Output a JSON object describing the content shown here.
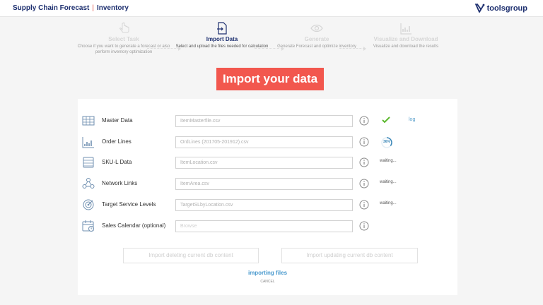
{
  "header": {
    "app_name": "Supply Chain Forecast",
    "separator": "|",
    "section": "Inventory",
    "brand": "toolsgroup"
  },
  "steps": [
    {
      "title": "Select Task",
      "desc": "Choose if you want to generate a forecast or also perform inventory optimization",
      "state": "done",
      "icon": "hand-pointer-icon"
    },
    {
      "title": "Import Data",
      "desc": "Select and upload the files needed for calculation",
      "state": "active",
      "icon": "file-import-icon"
    },
    {
      "title": "Generate",
      "desc": "Generate Forecast and optimize inventory",
      "state": "pending",
      "icon": "eye-icon"
    },
    {
      "title": "Visualize and Download",
      "desc": "Visualize and download the results",
      "state": "pending",
      "icon": "chart-icon"
    }
  ],
  "hero_title": "Import your data",
  "rows": [
    {
      "label": "Master Data",
      "file": "ItemMasterfile.csv",
      "status": "done",
      "log": "log",
      "icon": "table-icon"
    },
    {
      "label": "Order Lines",
      "file": "OrdLines (201705-201912).csv",
      "status": "progress",
      "progress": 36,
      "progress_text": "36%",
      "icon": "bar-chart-icon"
    },
    {
      "label": "SKU-L Data",
      "file": "ItemLocation.csv",
      "status": "waiting",
      "status_text": "waiting...",
      "icon": "database-icon"
    },
    {
      "label": "Network Links",
      "file": "ItemArea.csv",
      "status": "waiting",
      "status_text": "waiting...",
      "icon": "network-icon"
    },
    {
      "label": "Target Service Levels",
      "file": "TargetSLbyLocation.csv",
      "status": "waiting",
      "status_text": "waiting...",
      "icon": "target-icon"
    },
    {
      "label": "Sales Calendar (optional)",
      "file": "Browse",
      "status": "empty",
      "icon": "calendar-icon"
    }
  ],
  "buttons": {
    "delete_label": "Import deleting current db content",
    "update_label": "Import updating current db content"
  },
  "importing_text": "importing files",
  "cancel_label": "CANCEL",
  "colors": {
    "brand_navy": "#1d2f6f",
    "accent_red": "#f2574e",
    "link_blue": "#4a9ace",
    "success_green": "#5cb82e"
  }
}
